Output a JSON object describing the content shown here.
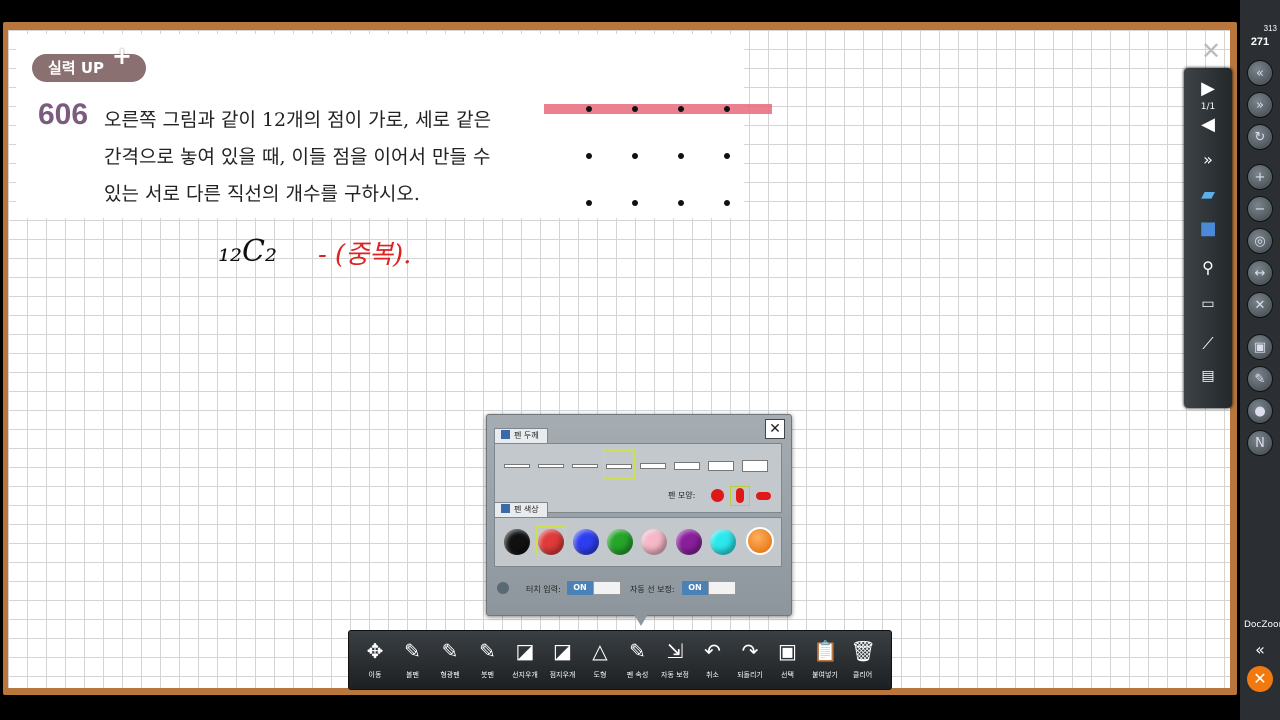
{
  "board": {
    "badge_text": "실력 UP",
    "badge_plus": "+",
    "question_number": "606",
    "question_text": "오른쪽 그림과 같이 12개의 점이 가로, 세로 같은\n간격으로 놓여 있을 때, 이들 점을 이어서 만들 수\n있는 서로 다른 직선의 개수를 구하시오.",
    "dot_rows": 3,
    "dot_cols": 4,
    "handwriting_black": "₁₂C₂",
    "handwriting_red": "- (중복)."
  },
  "page_close_icon": "close-icon",
  "right_panel": {
    "page_indicator": "1/1",
    "items": [
      "play-next-icon",
      "play-prev-icon",
      "fast-forward-icon",
      "folder-icon",
      "save-icon",
      "zoom-tool-icon",
      "page-view-icon",
      "pen-line-icon",
      "screen-capture-icon"
    ]
  },
  "sidebar": {
    "page_total": "313",
    "page_current": "271",
    "buttons": [
      "first-page-icon",
      "prev-page-icon",
      "refresh-icon",
      "zoom-in-icon",
      "zoom-out-icon",
      "fit-icon",
      "width-fit-icon",
      "fullscreen-icon",
      "bookmark-icon",
      "search-icon",
      "capture-icon",
      "note-icon"
    ],
    "brand": "DocZoom",
    "collapse": "«",
    "exit": "✕"
  },
  "pen_dialog": {
    "close": "✕",
    "thickness_title": "펜 두께",
    "shape_label": "펜 모양:",
    "color_title": "펜 색상",
    "touch_label": "터치 입력:",
    "touch_state": "ON",
    "autoline_label": "자동 선 보정:",
    "autoline_state": "ON",
    "colors": [
      "#111111",
      "#e03a3a",
      "#2d3ef0",
      "#25a52a",
      "#f6b8c8",
      "#8a1f9c",
      "#2ae8ee"
    ],
    "selected_color": "#e03a3a"
  },
  "toolbar": {
    "tools": [
      {
        "label": "이동",
        "icon": "move-icon"
      },
      {
        "label": "볼펜",
        "icon": "ballpen-icon"
      },
      {
        "label": "형광펜",
        "icon": "highlighter-icon"
      },
      {
        "label": "붓펜",
        "icon": "brushpen-icon"
      },
      {
        "label": "선지우개",
        "icon": "line-eraser-icon"
      },
      {
        "label": "점지우개",
        "icon": "point-eraser-icon"
      },
      {
        "label": "도형",
        "icon": "shape-icon"
      },
      {
        "label": "펜 속성",
        "icon": "pen-properties-icon"
      },
      {
        "label": "자동 보정",
        "icon": "auto-correct-icon"
      },
      {
        "label": "취소",
        "icon": "undo-icon"
      },
      {
        "label": "되돌리기",
        "icon": "redo-icon"
      },
      {
        "label": "선택",
        "icon": "select-icon"
      },
      {
        "label": "붙여넣기",
        "icon": "paste-icon"
      },
      {
        "label": "클리어",
        "icon": "clear-icon"
      }
    ]
  }
}
